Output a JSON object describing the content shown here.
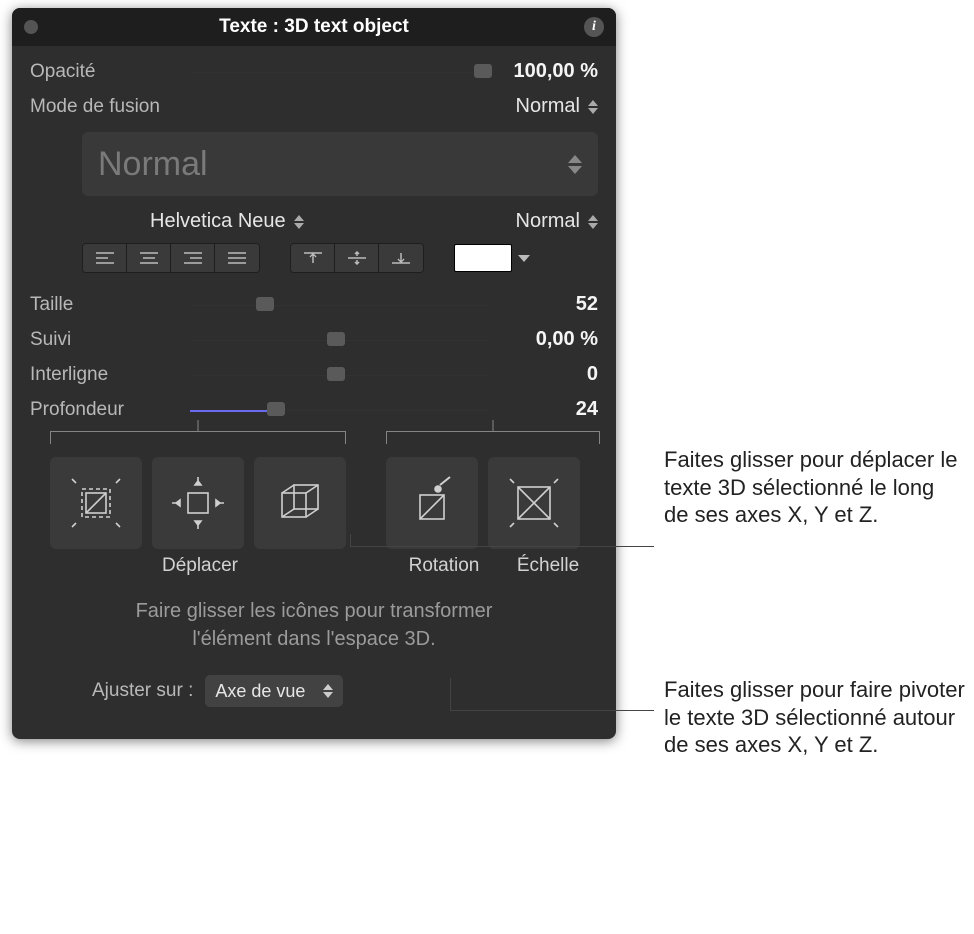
{
  "title": "Texte : 3D text object",
  "opacity": {
    "label": "Opacité",
    "value": "100,00 %"
  },
  "blend": {
    "label": "Mode de fusion",
    "value": "Normal"
  },
  "style": {
    "value": "Normal"
  },
  "font": {
    "family": "Helvetica Neue",
    "weight": "Normal"
  },
  "params": {
    "size": {
      "label": "Taille",
      "value": "52"
    },
    "tracking": {
      "label": "Suivi",
      "value": "0,00 %"
    },
    "leading": {
      "label": "Interligne",
      "value": "0"
    },
    "depth": {
      "label": "Profondeur",
      "value": "24"
    }
  },
  "groups": {
    "move": "Déplacer",
    "rotate": "Rotation",
    "scale": "Échelle"
  },
  "hint_line1": "Faire glisser les icônes pour transformer",
  "hint_line2": "l'élément dans l'espace 3D.",
  "adjust": {
    "label": "Ajuster sur :",
    "value": "Axe de vue"
  },
  "callout1": "Faites glisser pour déplacer le texte 3D sélectionné le long de ses axes X, Y et Z.",
  "callout2": "Faites glisser pour faire pivoter le texte 3D sélectionné autour de ses axes X, Y et Z."
}
